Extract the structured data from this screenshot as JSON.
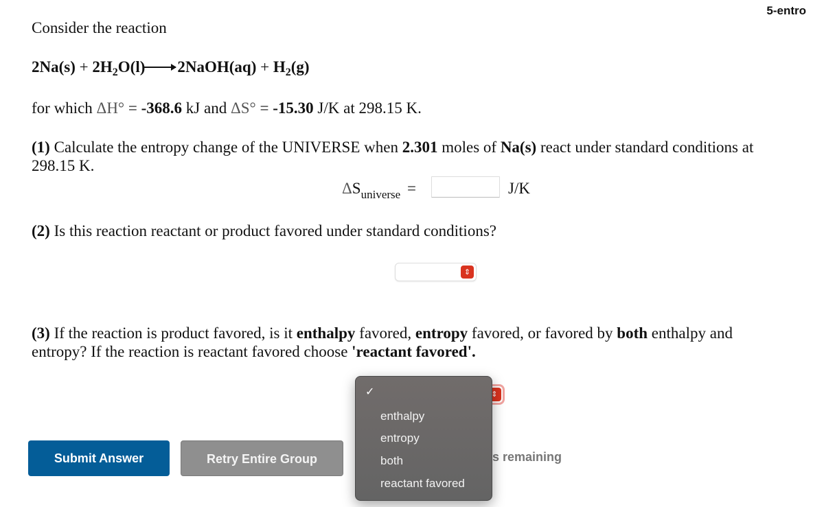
{
  "header": {
    "question_id": "5-entro"
  },
  "intro": "Consider the reaction",
  "equation": {
    "r1": "2Na(s)",
    "plus1": "+",
    "r2_pre": "2H",
    "r2_sub": "2",
    "r2_post": "O(l)",
    "p1": "2NaOH(aq)",
    "plus2": "+",
    "p2_pre": "H",
    "p2_sub": "2",
    "p2_post": "(g)"
  },
  "conditions": {
    "prefix": "for which",
    "dH_symbol": "ΔH°",
    "eq1": "=",
    "dH_value": "-368.6",
    "dH_unit": "kJ and",
    "dS_symbol": "ΔS°",
    "eq2": "=",
    "dS_value": "-15.30",
    "dS_unit": "J/K at 298.15 K."
  },
  "part1": {
    "num": "(1)",
    "text_a": "Calculate the entropy change of the UNIVERSE when",
    "moles": "2.301",
    "text_b": "moles of",
    "species": "Na(s)",
    "text_c": "react under standard conditions at",
    "line2": "298.15 K.",
    "label_delta": "Δ",
    "label_S": "S",
    "label_sub": "universe",
    "equals": "=",
    "input_value": "",
    "unit": "J/K"
  },
  "part2": {
    "num": "(2)",
    "text": "Is this reaction reactant or product favored under standard conditions?",
    "select_value": ""
  },
  "part3": {
    "num": "(3)",
    "t1": "If the reaction is product favored, is it",
    "b1": "enthalpy",
    "t2": "favored,",
    "b2": "entropy",
    "t3": "favored, or favored by",
    "b3": "both",
    "t4": "enthalpy and",
    "t5": "entropy? If the reaction is reactant favored choose",
    "b4": "'reactant favored'."
  },
  "dropdown": {
    "selected_check": "✓",
    "options": [
      "enthalpy",
      "entropy",
      "both",
      "reactant favored"
    ]
  },
  "buttons": {
    "submit": "Submit Answer",
    "retry": "Retry Entire Group"
  },
  "attempts_text": "ots remaining",
  "colors": {
    "submit": "#045d98",
    "retry": "#8f8f8f",
    "select_accent": "#d9331f"
  }
}
